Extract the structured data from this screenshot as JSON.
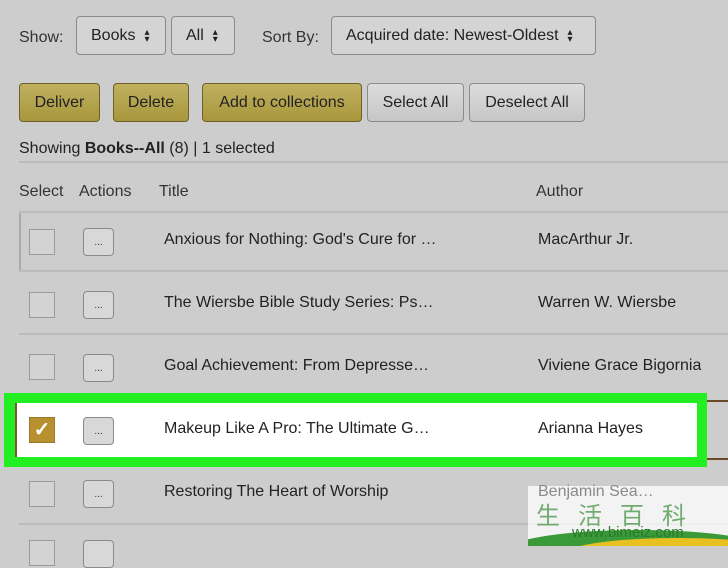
{
  "filters": {
    "show_label": "Show:",
    "type_value": "Books",
    "scope_value": "All",
    "sort_label": "Sort By:",
    "sort_value": "Acquired date: Newest-Oldest"
  },
  "actions": {
    "deliver": "Deliver",
    "delete": "Delete",
    "add_to_collections": "Add to collections",
    "select_all": "Select All",
    "deselect_all": "Deselect All"
  },
  "summary": {
    "prefix": "Showing ",
    "bold": "Books--All",
    "suffix": " (8) | 1 selected"
  },
  "columns": {
    "select": "Select",
    "actions": "Actions",
    "title": "Title",
    "author": "Author"
  },
  "rows": [
    {
      "title": "Anxious for Nothing: God's Cure for …",
      "author": "MacArthur Jr.",
      "selected": false,
      "action": "..."
    },
    {
      "title": "The Wiersbe Bible Study Series: Ps…",
      "author": "Warren W. Wiersbe",
      "selected": false,
      "action": "..."
    },
    {
      "title": "Goal Achievement: From Depresse…",
      "author": "Viviene Grace Bigornia",
      "selected": false,
      "action": "..."
    },
    {
      "title": "Makeup Like A Pro: The Ultimate G…",
      "author": "Arianna Hayes",
      "selected": true,
      "action": "..."
    },
    {
      "title": "Restoring The Heart of Worship",
      "author": "Benjamin Sea…",
      "selected": false,
      "action": "..."
    }
  ],
  "watermark": {
    "text": "生活百科",
    "url": "www.bimeiz.com"
  },
  "colors": {
    "highlight": "#22ee22",
    "checkbox_checked": "#b8902f",
    "gold_button": "#b3a24c"
  }
}
